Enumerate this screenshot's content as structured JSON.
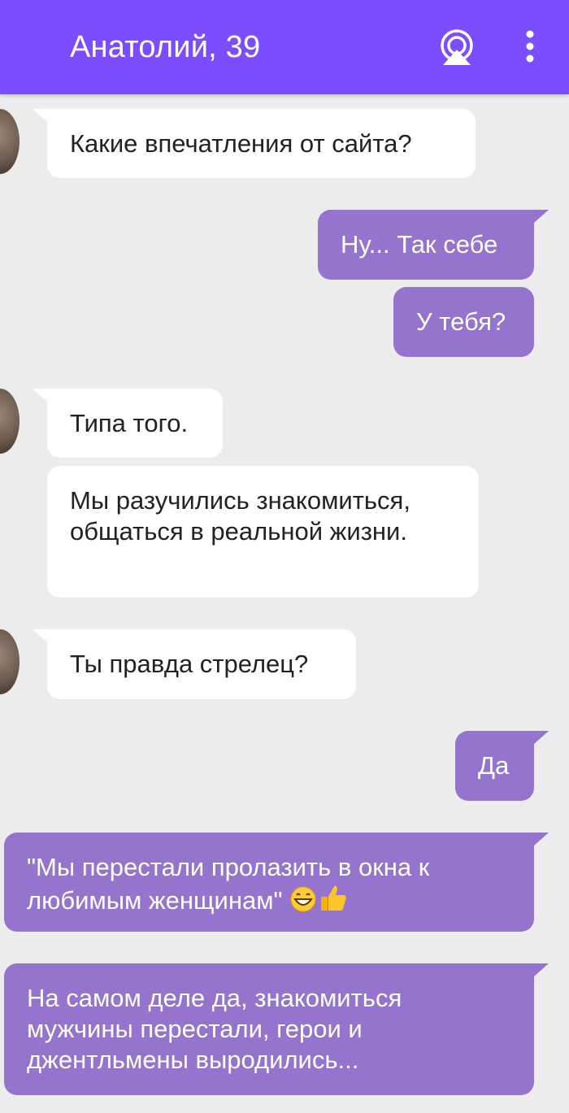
{
  "header": {
    "title": "Анатолий, 39",
    "icons": [
      "cast-icon",
      "more-vertical-icon"
    ],
    "color": "#7b4dff"
  },
  "chat": {
    "colors": {
      "incoming": "#ffffff",
      "outgoing": "#9474cc",
      "background": "#ececec"
    },
    "messages": [
      {
        "from": "other",
        "text": "Какие впечатления от сайта?"
      },
      {
        "from": "me",
        "text": "Ну... Так себе"
      },
      {
        "from": "me",
        "text": "У тебя?"
      },
      {
        "from": "other",
        "text": "Типа того."
      },
      {
        "from": "other",
        "text": "Мы разучились знакомиться, общаться в реальной жизни."
      },
      {
        "from": "other",
        "text": "Ты правда стрелец?"
      },
      {
        "from": "me",
        "text": "Да"
      },
      {
        "from": "me",
        "text": "\"Мы перестали пролазить в окна к любимым женщинам\"",
        "emojis": [
          "grinning-face-icon",
          "thumbs-up-icon"
        ]
      },
      {
        "from": "me",
        "text": "На самом деле да, знакомиться мужчины перестали, герои и джентльмены выродились..."
      }
    ]
  }
}
